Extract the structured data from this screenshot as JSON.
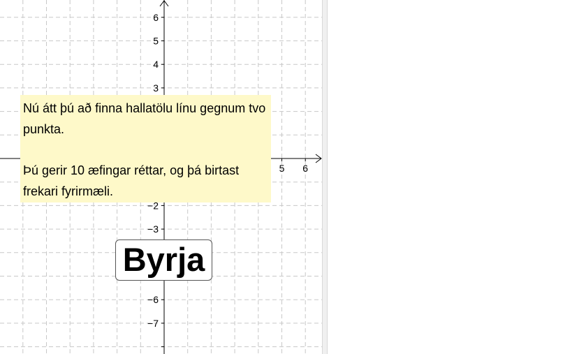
{
  "graph": {
    "x_tick_labels": [
      "5",
      "6"
    ],
    "y_tick_labels": [
      "6",
      "5",
      "4",
      "3",
      "−2",
      "−3",
      "−6",
      "−7"
    ]
  },
  "instructions": {
    "paragraph_1": "Nú átt þú að finna hallatölu línu gegnum tvo punkta.",
    "paragraph_2": "Þú gerir 10 æfingar réttar, og þá birtast frekari fyrirmæli."
  },
  "start_button": {
    "label": "Byrja"
  },
  "colors": {
    "grid": "#c8c8c8",
    "axis": "#000000",
    "note_background": "#fef9c9"
  }
}
